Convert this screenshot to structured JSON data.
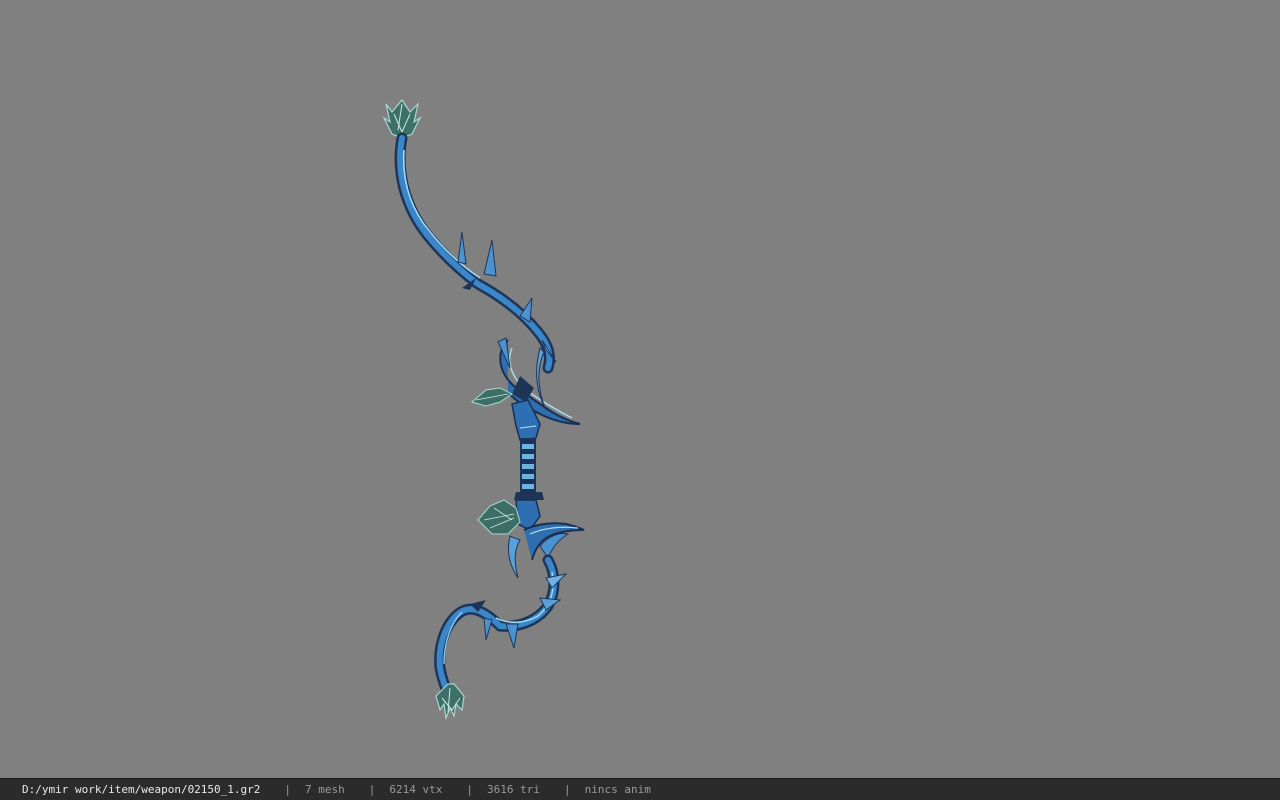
{
  "viewer": {
    "background_color": "#808080",
    "model_name": "bow-model",
    "model_colors": {
      "dark": "#1f3558",
      "mid": "#2e6fb3",
      "light": "#8fd0f0",
      "leaf": "#3d6e66",
      "leaf_light": "#a9d9cf"
    }
  },
  "status_bar": {
    "file_path": "D:/ymir work/item/weapon/02150_1.gr2",
    "separator": "|",
    "mesh": "7 mesh",
    "vertices": "6214 vtx",
    "triangles": "3616 tri",
    "animation": "nincs anim"
  }
}
